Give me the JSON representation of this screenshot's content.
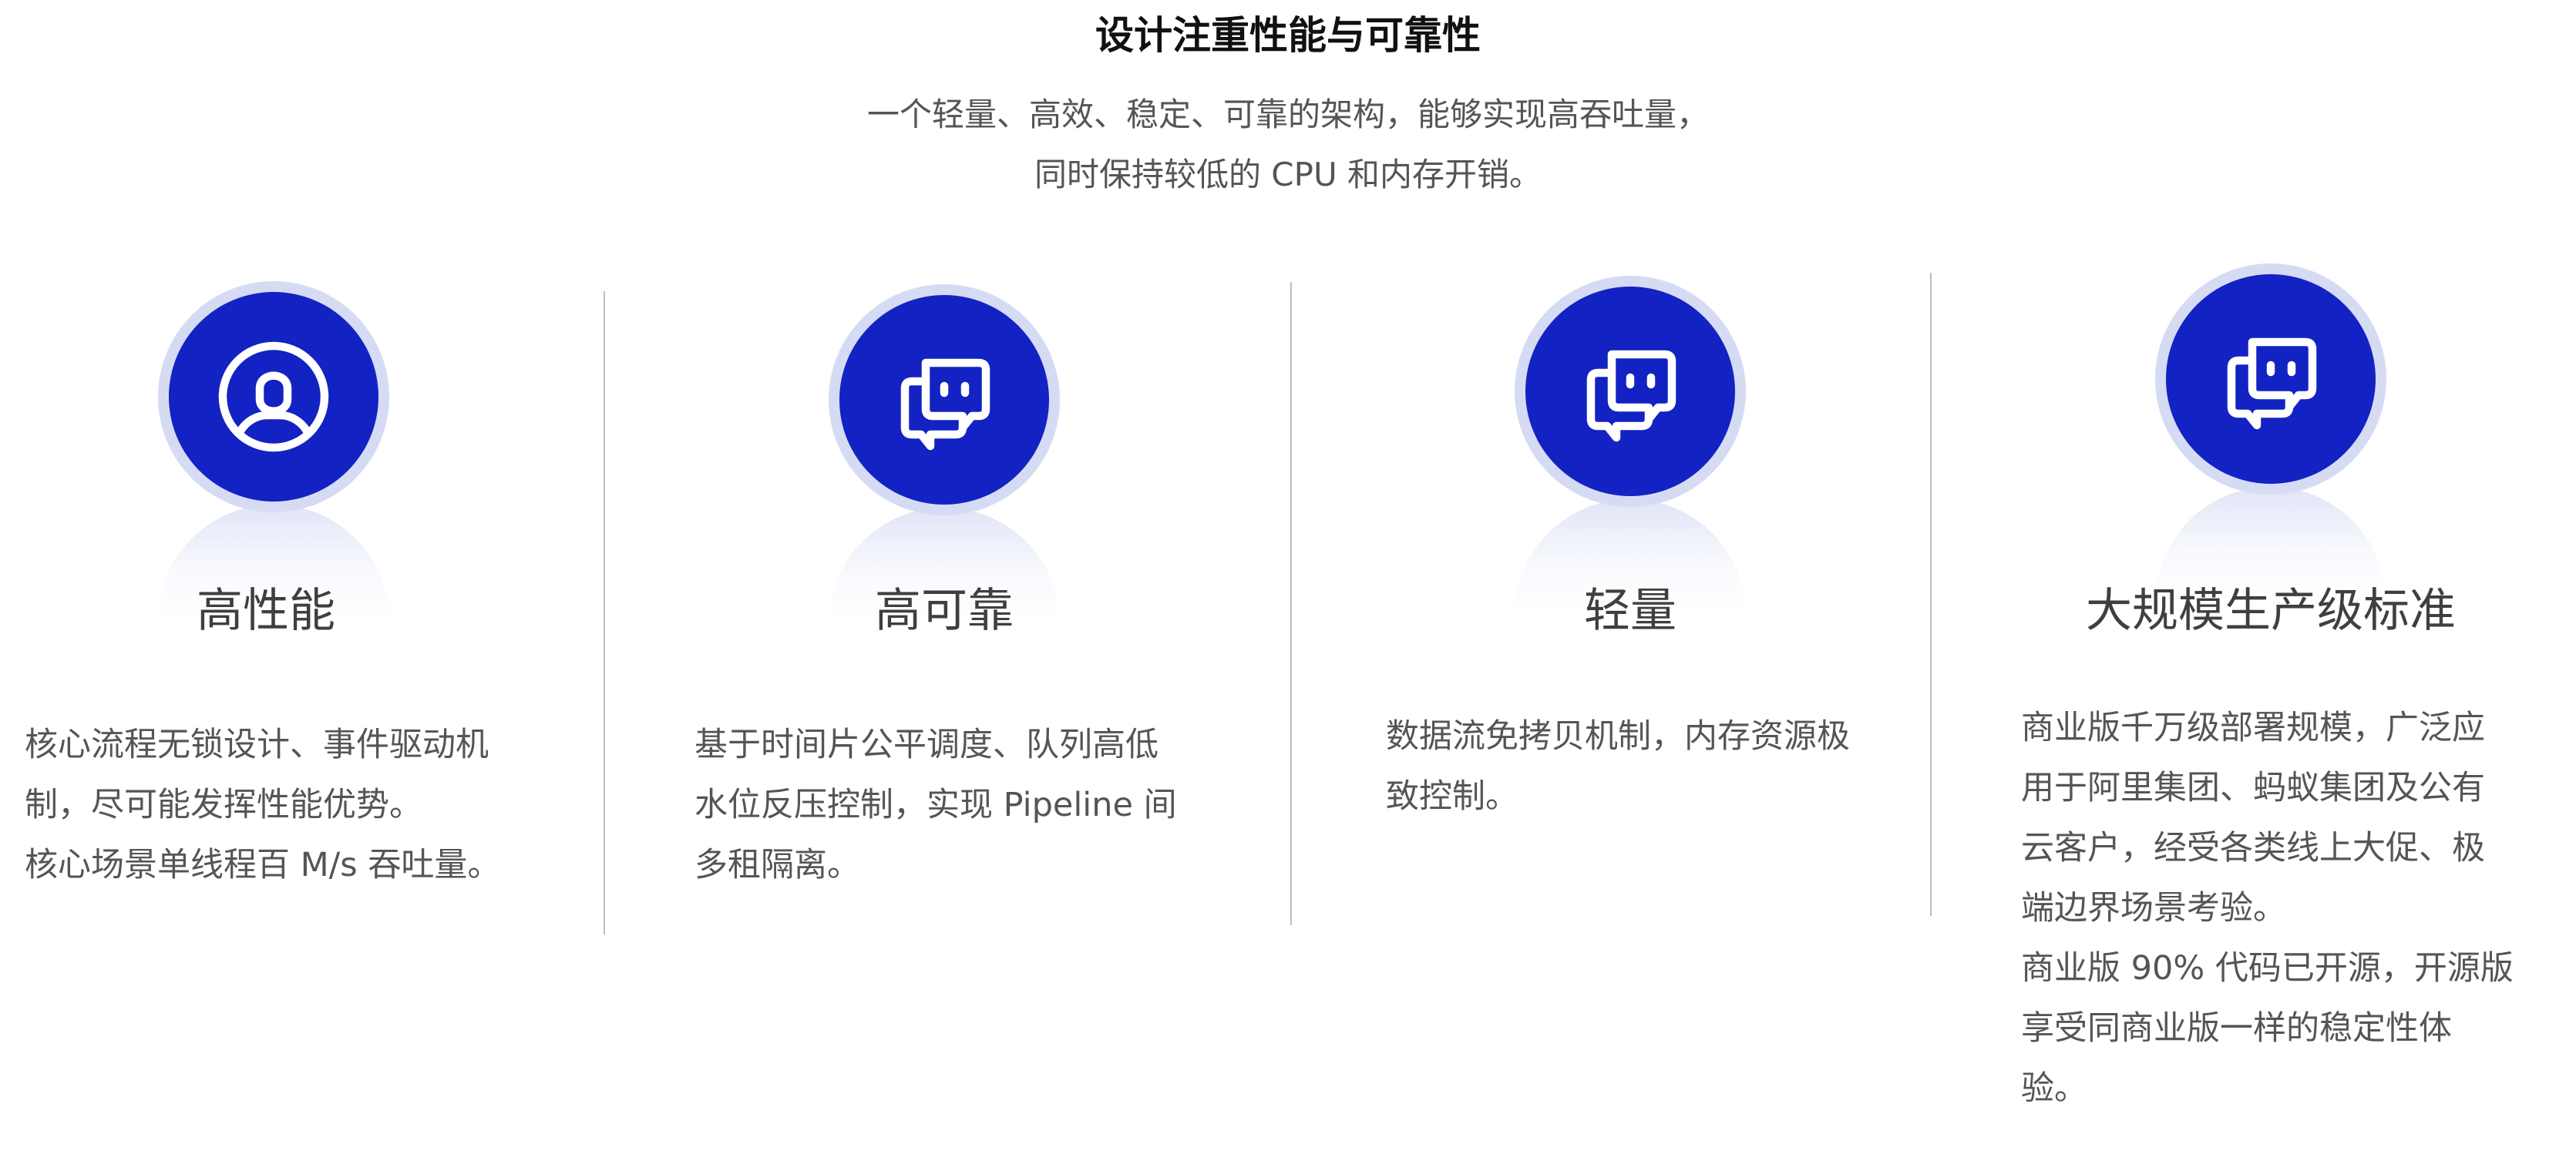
{
  "header": {
    "title": "设计注重性能与可靠性",
    "subtitle_line1": "一个轻量、高效、稳定、可靠的架构，能够实现高吞吐量，",
    "subtitle_line2": "同时保持较低的 CPU 和内存开销。"
  },
  "features": [
    {
      "icon": "user-icon",
      "title": "高性能",
      "desc": [
        "核心流程无锁设计、事件驱动机",
        "制，尽可能发挥性能优势。",
        "核心场景单线程百 M/s 吞吐量。"
      ]
    },
    {
      "icon": "chat-bubbles-icon",
      "title": "高可靠",
      "desc": [
        "基于时间片公平调度、队列高低",
        "水位反压控制，实现 Pipeline 间",
        "多租隔离。"
      ]
    },
    {
      "icon": "chat-bubbles-icon",
      "title": "轻量",
      "desc": [
        "数据流免拷贝机制，内存资源极",
        "致控制。"
      ]
    },
    {
      "icon": "chat-bubbles-icon",
      "title": "大规模生产级标准",
      "desc": [
        "商业版千万级部署规模，广泛应",
        "用于阿里集团、蚂蚁集团及公有",
        "云客户，经受各类线上大促、极",
        "端边界场景考验。",
        "商业版 90% 代码已开源，开源版",
        "享受同商业版一样的稳定性体",
        "验。"
      ]
    }
  ],
  "colors": {
    "icon_circle": "#1322c2",
    "icon_ring": "#d6dbf4",
    "title_text": "#111111",
    "body_text": "#555555",
    "divider": "#bdbdbd"
  }
}
